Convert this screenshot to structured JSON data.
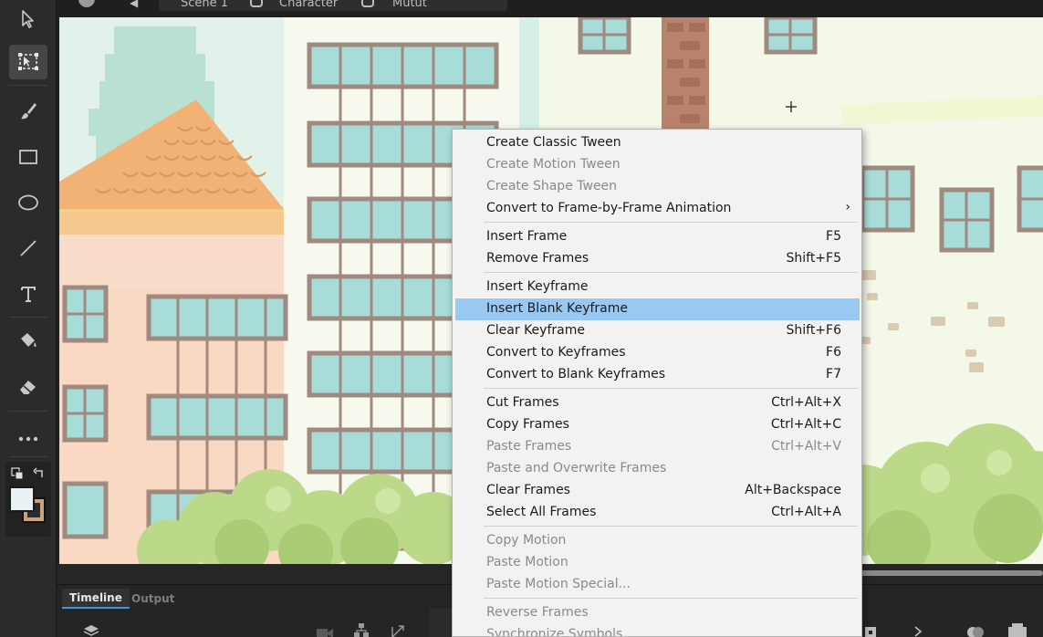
{
  "breadcrumb": {
    "scene": "Scene 1",
    "symbol1": "Character",
    "symbol2": "Mutut"
  },
  "tools": [
    {
      "name": "selection-tool",
      "icon": "arrow-icon"
    },
    {
      "name": "free-transform-tool",
      "icon": "free-transform-icon",
      "active": true
    },
    {
      "name": "brush-tool",
      "icon": "brush-icon"
    },
    {
      "name": "rectangle-tool",
      "icon": "rectangle-icon"
    },
    {
      "name": "oval-tool",
      "icon": "oval-icon"
    },
    {
      "name": "line-tool",
      "icon": "line-icon"
    },
    {
      "name": "text-tool",
      "icon": "text-icon"
    },
    {
      "name": "paint-bucket-tool",
      "icon": "paint-bucket-icon"
    },
    {
      "name": "eraser-tool",
      "icon": "eraser-icon"
    },
    {
      "name": "more-tools",
      "icon": "ellipsis-icon"
    }
  ],
  "colors": {
    "stroke": "#c9a27e",
    "fill": "#e8f1f4",
    "accent": "#99c9f3"
  },
  "panel": {
    "tab_timeline": "Timeline",
    "tab_output": "Output"
  },
  "menu": {
    "create_classic_tween": "Create Classic Tween",
    "create_motion_tween": "Create Motion Tween",
    "create_shape_tween": "Create Shape Tween",
    "convert_frame_by_frame": "Convert to Frame-by-Frame Animation",
    "insert_frame": "Insert Frame",
    "insert_frame_sc": "F5",
    "remove_frames": "Remove Frames",
    "remove_frames_sc": "Shift+F5",
    "insert_keyframe": "Insert Keyframe",
    "insert_blank_keyframe": "Insert Blank Keyframe",
    "clear_keyframe": "Clear Keyframe",
    "clear_keyframe_sc": "Shift+F6",
    "convert_to_keyframes": "Convert to Keyframes",
    "convert_to_keyframes_sc": "F6",
    "convert_to_blank_keyframes": "Convert to Blank Keyframes",
    "convert_to_blank_keyframes_sc": "F7",
    "cut_frames": "Cut Frames",
    "cut_frames_sc": "Ctrl+Alt+X",
    "copy_frames": "Copy Frames",
    "copy_frames_sc": "Ctrl+Alt+C",
    "paste_frames": "Paste Frames",
    "paste_frames_sc": "Ctrl+Alt+V",
    "paste_overwrite_frames": "Paste and Overwrite Frames",
    "clear_frames": "Clear Frames",
    "clear_frames_sc": "Alt+Backspace",
    "select_all_frames": "Select All Frames",
    "select_all_frames_sc": "Ctrl+Alt+A",
    "copy_motion": "Copy Motion",
    "paste_motion": "Paste Motion",
    "paste_motion_special": "Paste Motion Special...",
    "reverse_frames": "Reverse Frames",
    "synchronize_symbols": "Synchronize Symbols"
  }
}
